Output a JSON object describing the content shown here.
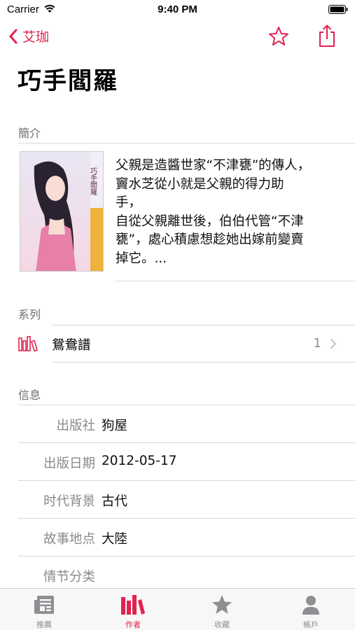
{
  "status_bar": {
    "carrier": "Carrier",
    "time": "9:40 PM"
  },
  "nav": {
    "back_label": "艾珈"
  },
  "page_title": "巧手閻羅",
  "intro": {
    "header": "簡介",
    "lines": [
      "父親是造醬世家“不津甕”的傳人，",
      "竇水芝從小就是父親的得力助",
      "手，",
      "自從父親離世後，伯伯代管“不津",
      "甕”，處心積慮想趁她出嫁前變賣",
      "掉它。..."
    ]
  },
  "series": {
    "header": "系列",
    "name": "鴛鴦譜",
    "count": "1"
  },
  "info": {
    "header": "信息",
    "rows": [
      {
        "label": "出版社",
        "value": "狗屋"
      },
      {
        "label": "出版日期",
        "value": "2012-05-17"
      },
      {
        "label": "时代背景",
        "value": "古代"
      },
      {
        "label": "故事地点",
        "value": "大陸"
      },
      {
        "label": "情节分类",
        "value": ""
      }
    ]
  },
  "tabs": [
    {
      "label": "推薦",
      "icon": "newspaper-icon",
      "active": false
    },
    {
      "label": "作者",
      "icon": "books-icon",
      "active": true
    },
    {
      "label": "收藏",
      "icon": "star-icon",
      "active": false
    },
    {
      "label": "帳戶",
      "icon": "person-icon",
      "active": false
    }
  ],
  "colors": {
    "accent": "#e0224f",
    "secondary_text": "#8e8e93",
    "divider": "#d8d8dc"
  }
}
